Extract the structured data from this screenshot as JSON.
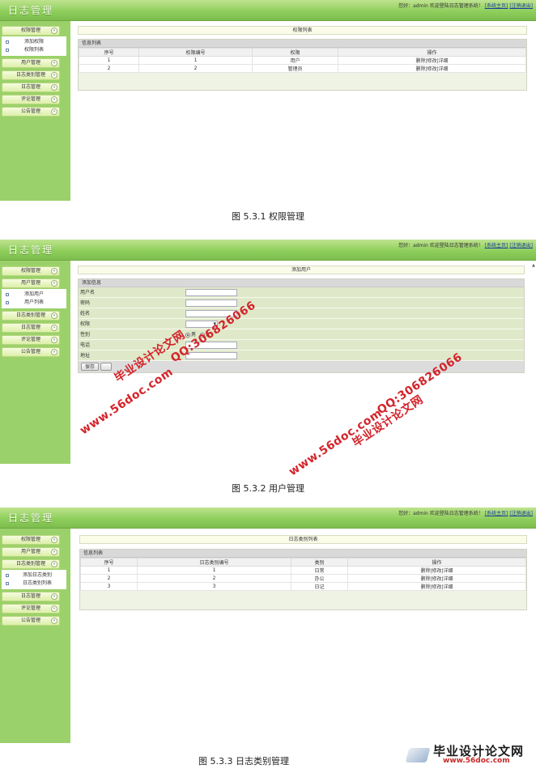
{
  "common": {
    "logo": "日志管理",
    "welcome": "您好：admin 欢迎登陆日志管理系统！",
    "home_link": "[系统主页]",
    "logout_link": "[注销退出]",
    "arrow": "»"
  },
  "shot1": {
    "sidebar": {
      "items": [
        "权限管理",
        "用户管理",
        "日志类别管理",
        "日志管理",
        "评论管理",
        "公告管理"
      ],
      "subitems": [
        "添加权限",
        "权限列表"
      ]
    },
    "title": "权限列表",
    "panel_title": "信息列表",
    "columns": [
      "序号",
      "权限编号",
      "权限",
      "操作"
    ],
    "rows": [
      [
        "1",
        "1",
        "用户",
        "删除|修改|详细"
      ],
      [
        "2",
        "2",
        "管理员",
        "删除|修改|详细"
      ]
    ],
    "caption": "图 5.3.1  权限管理"
  },
  "shot2": {
    "sidebar": {
      "items": [
        "权限管理",
        "用户管理",
        "日志类别管理",
        "日志管理",
        "评论管理",
        "公告管理"
      ],
      "subitems": [
        "添加用户",
        "用户列表"
      ]
    },
    "title": "添加用户",
    "panel_title": "添加信息",
    "fields": [
      "用户名",
      "密码",
      "姓名",
      "权限",
      "性别",
      "电话",
      "地址"
    ],
    "gender_male": "男",
    "gender_female": "女",
    "save_label": "保存",
    "caption": "图 5.3.2  用户管理"
  },
  "shot3": {
    "sidebar": {
      "items": [
        "权限管理",
        "用户管理",
        "日志类别管理",
        "日志管理",
        "评论管理",
        "公告管理"
      ],
      "subitems": [
        "添加日志类别",
        "日志类别列表"
      ]
    },
    "title": "日志类别列表",
    "panel_title": "信息列表",
    "columns": [
      "序号",
      "日志类别编号",
      "类别",
      "操作"
    ],
    "rows": [
      [
        "1",
        "1",
        "日常",
        "删除|修改|详细"
      ],
      [
        "2",
        "2",
        "办公",
        "删除|修改|详细"
      ],
      [
        "3",
        "3",
        "日记",
        "删除|修改|详细"
      ]
    ],
    "caption": "图 5.3.3  日志类别管理"
  },
  "watermarks": {
    "site": "www.56doc.com",
    "qq": "QQ:306826066",
    "name": "毕业设计论文网"
  },
  "corner_logo": {
    "big": "毕业设计论文网",
    "small": "www.56doc.com"
  }
}
